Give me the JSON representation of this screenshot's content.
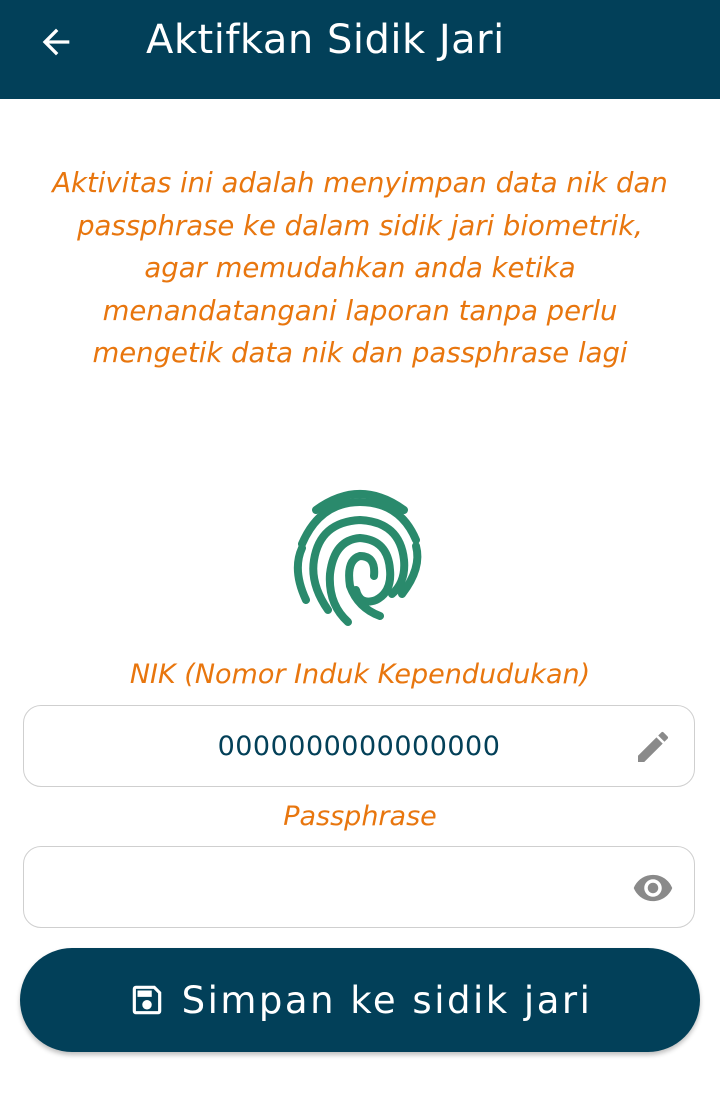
{
  "appbar": {
    "title": "Aktifkan Sidik Jari",
    "back_icon": "arrow-left-icon",
    "background_color": "#024059"
  },
  "description": "Aktivitas ini adalah menyimpan data nik dan passphrase ke dalam sidik jari biometrik, agar memudahkan anda ketika menandatangani laporan tanpa perlu mengetik data nik dan passphrase lagi",
  "fingerprint": {
    "icon": "fingerprint-icon",
    "color": "#2a8a6c"
  },
  "nik": {
    "label": "NIK (Nomor Induk Kependudukan)",
    "value": "0000000000000000",
    "icon": "pencil-icon"
  },
  "passphrase": {
    "label": "Passphrase",
    "value": "",
    "icon": "eye-icon"
  },
  "save_button": {
    "label": "Simpan ke sidik jari",
    "icon": "save-icon"
  },
  "colors": {
    "accent": "#e8760e",
    "primary": "#024059",
    "icon_gray": "#8a8a8a"
  }
}
